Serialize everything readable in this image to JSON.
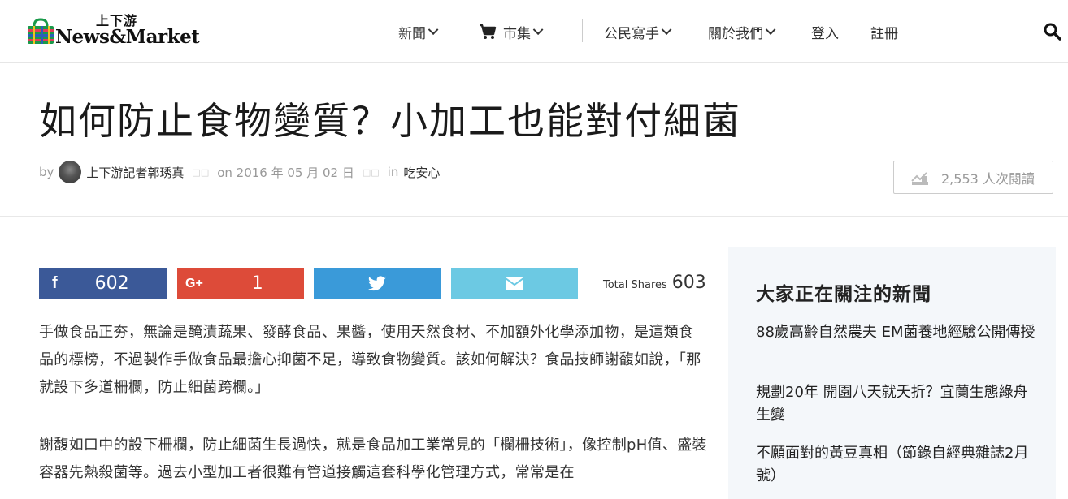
{
  "logo": {
    "cn": "上下游",
    "en": "News&Market"
  },
  "nav": {
    "items": [
      {
        "label": "新聞"
      },
      {
        "label": "市集"
      },
      {
        "label": "公民寫手"
      },
      {
        "label": "關於我們"
      },
      {
        "label": "登入"
      },
      {
        "label": "註冊"
      }
    ]
  },
  "article": {
    "title": "如何防止食物變質？小加工也能對付細菌",
    "by": "by",
    "author": "上下游記者郭琇真",
    "on": "on 2016 年 05 月 02 日",
    "in": "in",
    "category": "吃安心",
    "views": "2,553 人次閱讀"
  },
  "share": {
    "facebook_count": "602",
    "gplus_count": "1",
    "total_label": "Total Shares",
    "total_count": "603"
  },
  "body": {
    "p1": "手做食品正夯，無論是醃漬蔬果、發酵食品、果醬，使用天然食材、不加額外化學添加物，是這類食品的標榜，不過製作手做食品最擔心抑菌不足，導致食物變質。該如何解決？食品技師謝馥如說，「那就設下多道柵欄，防止細菌跨欄。」",
    "p2": "謝馥如口中的設下柵欄，防止細菌生長過快，就是食品加工業常見的「欄柵技術」，像控制pH值、盛裝容器先熱殺菌等。過去小型加工者很難有管道接觸這套科學化管理方式，常常是在"
  },
  "sidebar": {
    "title": "大家正在關注的新聞",
    "items": [
      "88歲高齡自然農夫 EM菌養地經驗公開傳授",
      "規劃20年 開園八天就夭折？宜蘭生態綠舟生變",
      "不願面對的黃豆真相（節錄自經典雜誌2月號）"
    ]
  },
  "colors": {
    "facebook": "#3b5998",
    "gplus": "#dd4b39",
    "twitter": "#3a9ad9",
    "email": "#6cc9e3",
    "sidebar_bg": "#f4f7fa"
  }
}
